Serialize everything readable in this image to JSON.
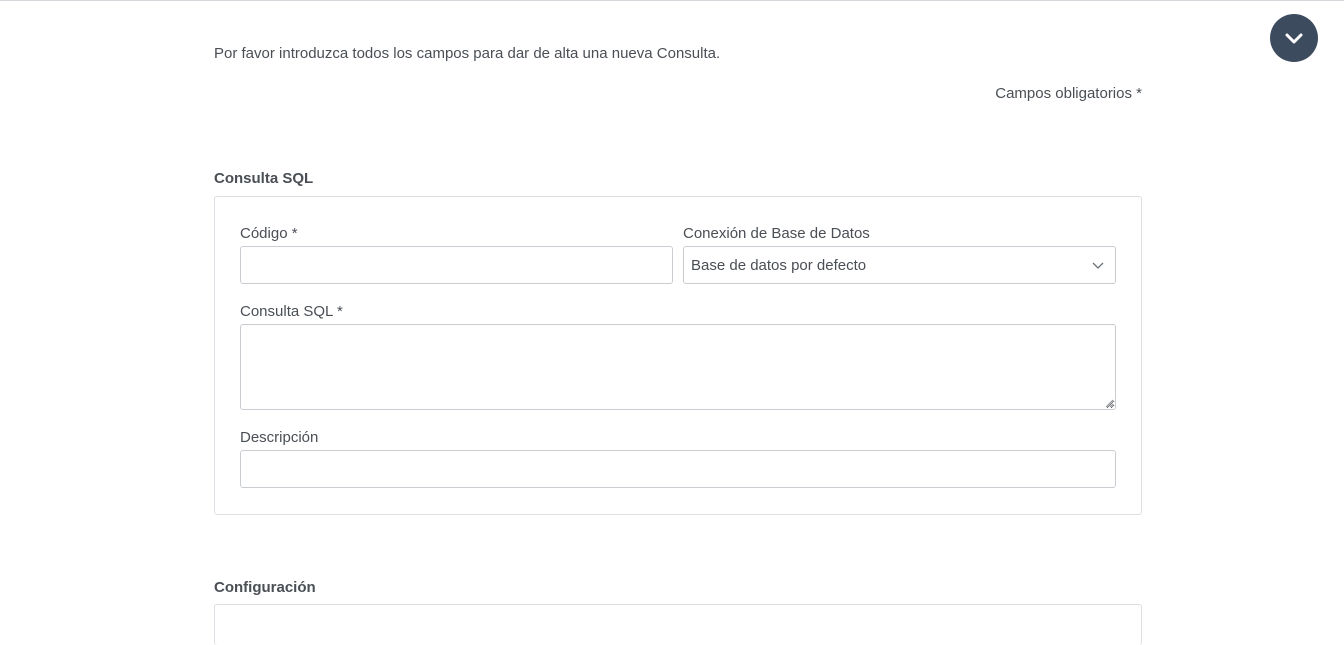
{
  "page": {
    "intro_text": "Por favor introduzca todos los campos para dar de alta una nueva Consulta.",
    "required_note": "Campos obligatorios *",
    "scroll_button_icon": "chevron-down-icon",
    "accent_color": "#3d4b5f"
  },
  "sql_section": {
    "title": "Consulta SQL",
    "code_label": "Código *",
    "code_value": "",
    "connection_label": "Conexión de Base de Datos",
    "connection_selected": "Base de datos por defecto",
    "query_label": "Consulta SQL *",
    "query_value": "",
    "description_label": "Descripción",
    "description_value": ""
  },
  "config_section": {
    "title": "Configuración"
  }
}
